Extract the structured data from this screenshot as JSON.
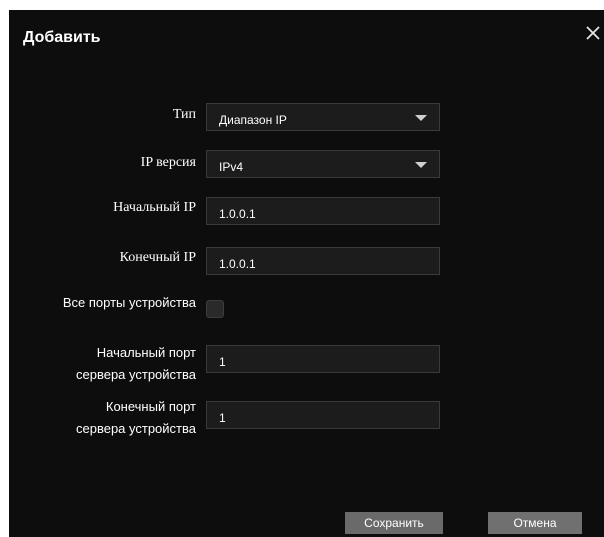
{
  "dialog": {
    "title": "Добавить",
    "close_icon": "close-icon"
  },
  "form": {
    "type": {
      "label": "Тип",
      "value": "Диапазон IP"
    },
    "ip_version": {
      "label": "IP версия",
      "value": "IPv4"
    },
    "start_ip": {
      "label": "Начальный IP",
      "value": "1.0.0.1"
    },
    "end_ip": {
      "label": "Конечный IP",
      "value": "1.0.0.1"
    },
    "all_ports": {
      "label": "Все порты устройства",
      "checked": false
    },
    "start_port": {
      "label_line1": "Начальный порт",
      "label_line2": "сервера устройства",
      "value": "1"
    },
    "end_port": {
      "label_line1": "Конечный порт",
      "label_line2": "сервера устройства",
      "value": "1"
    }
  },
  "buttons": {
    "save_label": "Сохранить",
    "cancel_label": "Отмена"
  },
  "colors": {
    "background": "#0d0d0d",
    "field": "#1c1c1c",
    "button": "#6c6c6c",
    "text": "#ffffff"
  }
}
